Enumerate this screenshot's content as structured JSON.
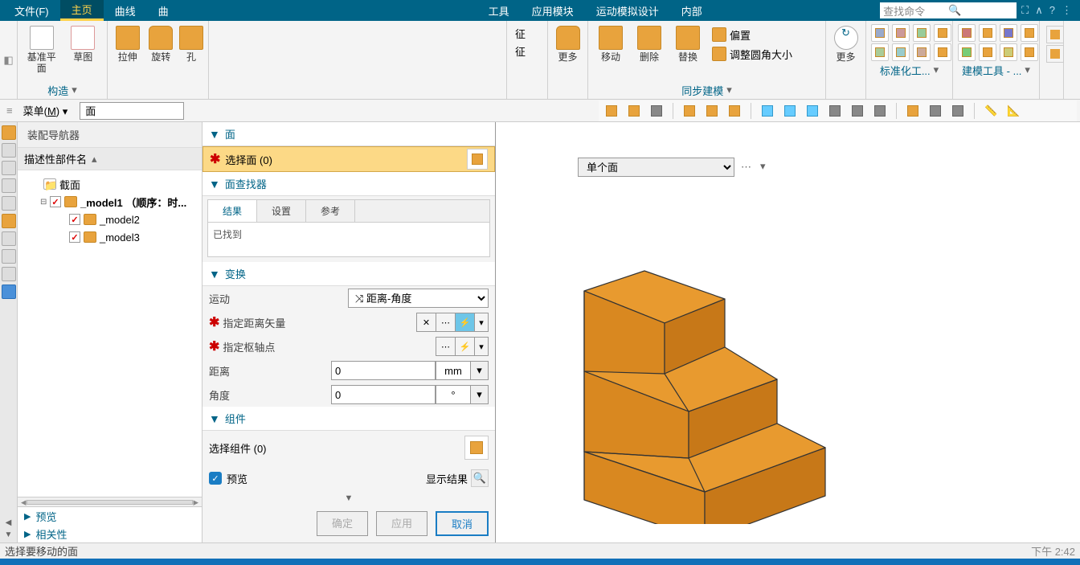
{
  "menu": {
    "file": "文件(F)",
    "home": "主页",
    "curve": "曲线",
    "curve2": "曲",
    "tool": "工具",
    "appmod": "应用模块",
    "motion": "运动模拟设计",
    "internal": "内部"
  },
  "search_placeholder": "查找命令",
  "ribbon": {
    "construct": {
      "label": "构造",
      "datum_plane": "基准平面",
      "sketch": "草图"
    },
    "feature": {
      "extrude": "拉伸",
      "revolve": "旋转",
      "hole": "孔"
    },
    "feat_label1": "征",
    "feat_label2": "征",
    "more1": "更多",
    "sync": {
      "label": "同步建模",
      "move": "移动",
      "delete": "删除",
      "replace": "替换",
      "offset": "偏置",
      "resize_fillet": "调整圆角大小"
    },
    "more2": "更多",
    "standard": "标准化工...",
    "modeling": "建模工具 - ..."
  },
  "submenu": {
    "menu_btn": "菜单(M)",
    "input_val": "面"
  },
  "nav": {
    "title": "装配导航器",
    "header": "描述性部件名",
    "items": {
      "sections": "截面",
      "model1": "_model1 （顺序：时...",
      "model2": "_model2",
      "model3": "_model3"
    },
    "preview": "预览",
    "relativity": "相关性"
  },
  "dlg": {
    "face_section": "面",
    "select_faces": "选择面 (0)",
    "face_finder": "面查找器",
    "tabs": {
      "results": "结果",
      "settings": "设置",
      "reference": "参考"
    },
    "found": "已找到",
    "transform_section": "变换",
    "motion": "运动",
    "motion_val": "⤨ 距离-角度",
    "specify_dist_vec": "指定距离矢量",
    "specify_pivot": "指定枢轴点",
    "distance": "距离",
    "distance_val": "0",
    "distance_unit": "mm",
    "angle": "角度",
    "angle_val": "0",
    "angle_unit": "°",
    "component_section": "组件",
    "select_components": "选择组件 (0)",
    "preview": "预览",
    "show_result": "显示结果",
    "ok": "确定",
    "apply": "应用",
    "cancel": "取消"
  },
  "viewport": {
    "filter_val": "单个面"
  },
  "status": "选择要移动的面",
  "time": "下午   2:42"
}
